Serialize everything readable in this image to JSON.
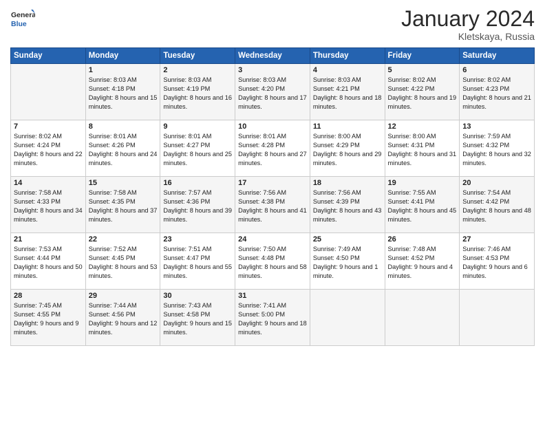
{
  "header": {
    "logo_general": "General",
    "logo_blue": "Blue",
    "month_title": "January 2024",
    "location": "Kletskaya, Russia"
  },
  "days_of_week": [
    "Sunday",
    "Monday",
    "Tuesday",
    "Wednesday",
    "Thursday",
    "Friday",
    "Saturday"
  ],
  "weeks": [
    [
      {
        "day": "",
        "sunrise": "",
        "sunset": "",
        "daylight": ""
      },
      {
        "day": "1",
        "sunrise": "Sunrise: 8:03 AM",
        "sunset": "Sunset: 4:18 PM",
        "daylight": "Daylight: 8 hours and 15 minutes."
      },
      {
        "day": "2",
        "sunrise": "Sunrise: 8:03 AM",
        "sunset": "Sunset: 4:19 PM",
        "daylight": "Daylight: 8 hours and 16 minutes."
      },
      {
        "day": "3",
        "sunrise": "Sunrise: 8:03 AM",
        "sunset": "Sunset: 4:20 PM",
        "daylight": "Daylight: 8 hours and 17 minutes."
      },
      {
        "day": "4",
        "sunrise": "Sunrise: 8:03 AM",
        "sunset": "Sunset: 4:21 PM",
        "daylight": "Daylight: 8 hours and 18 minutes."
      },
      {
        "day": "5",
        "sunrise": "Sunrise: 8:02 AM",
        "sunset": "Sunset: 4:22 PM",
        "daylight": "Daylight: 8 hours and 19 minutes."
      },
      {
        "day": "6",
        "sunrise": "Sunrise: 8:02 AM",
        "sunset": "Sunset: 4:23 PM",
        "daylight": "Daylight: 8 hours and 21 minutes."
      }
    ],
    [
      {
        "day": "7",
        "sunrise": "Sunrise: 8:02 AM",
        "sunset": "Sunset: 4:24 PM",
        "daylight": "Daylight: 8 hours and 22 minutes."
      },
      {
        "day": "8",
        "sunrise": "Sunrise: 8:01 AM",
        "sunset": "Sunset: 4:26 PM",
        "daylight": "Daylight: 8 hours and 24 minutes."
      },
      {
        "day": "9",
        "sunrise": "Sunrise: 8:01 AM",
        "sunset": "Sunset: 4:27 PM",
        "daylight": "Daylight: 8 hours and 25 minutes."
      },
      {
        "day": "10",
        "sunrise": "Sunrise: 8:01 AM",
        "sunset": "Sunset: 4:28 PM",
        "daylight": "Daylight: 8 hours and 27 minutes."
      },
      {
        "day": "11",
        "sunrise": "Sunrise: 8:00 AM",
        "sunset": "Sunset: 4:29 PM",
        "daylight": "Daylight: 8 hours and 29 minutes."
      },
      {
        "day": "12",
        "sunrise": "Sunrise: 8:00 AM",
        "sunset": "Sunset: 4:31 PM",
        "daylight": "Daylight: 8 hours and 31 minutes."
      },
      {
        "day": "13",
        "sunrise": "Sunrise: 7:59 AM",
        "sunset": "Sunset: 4:32 PM",
        "daylight": "Daylight: 8 hours and 32 minutes."
      }
    ],
    [
      {
        "day": "14",
        "sunrise": "Sunrise: 7:58 AM",
        "sunset": "Sunset: 4:33 PM",
        "daylight": "Daylight: 8 hours and 34 minutes."
      },
      {
        "day": "15",
        "sunrise": "Sunrise: 7:58 AM",
        "sunset": "Sunset: 4:35 PM",
        "daylight": "Daylight: 8 hours and 37 minutes."
      },
      {
        "day": "16",
        "sunrise": "Sunrise: 7:57 AM",
        "sunset": "Sunset: 4:36 PM",
        "daylight": "Daylight: 8 hours and 39 minutes."
      },
      {
        "day": "17",
        "sunrise": "Sunrise: 7:56 AM",
        "sunset": "Sunset: 4:38 PM",
        "daylight": "Daylight: 8 hours and 41 minutes."
      },
      {
        "day": "18",
        "sunrise": "Sunrise: 7:56 AM",
        "sunset": "Sunset: 4:39 PM",
        "daylight": "Daylight: 8 hours and 43 minutes."
      },
      {
        "day": "19",
        "sunrise": "Sunrise: 7:55 AM",
        "sunset": "Sunset: 4:41 PM",
        "daylight": "Daylight: 8 hours and 45 minutes."
      },
      {
        "day": "20",
        "sunrise": "Sunrise: 7:54 AM",
        "sunset": "Sunset: 4:42 PM",
        "daylight": "Daylight: 8 hours and 48 minutes."
      }
    ],
    [
      {
        "day": "21",
        "sunrise": "Sunrise: 7:53 AM",
        "sunset": "Sunset: 4:44 PM",
        "daylight": "Daylight: 8 hours and 50 minutes."
      },
      {
        "day": "22",
        "sunrise": "Sunrise: 7:52 AM",
        "sunset": "Sunset: 4:45 PM",
        "daylight": "Daylight: 8 hours and 53 minutes."
      },
      {
        "day": "23",
        "sunrise": "Sunrise: 7:51 AM",
        "sunset": "Sunset: 4:47 PM",
        "daylight": "Daylight: 8 hours and 55 minutes."
      },
      {
        "day": "24",
        "sunrise": "Sunrise: 7:50 AM",
        "sunset": "Sunset: 4:48 PM",
        "daylight": "Daylight: 8 hours and 58 minutes."
      },
      {
        "day": "25",
        "sunrise": "Sunrise: 7:49 AM",
        "sunset": "Sunset: 4:50 PM",
        "daylight": "Daylight: 9 hours and 1 minute."
      },
      {
        "day": "26",
        "sunrise": "Sunrise: 7:48 AM",
        "sunset": "Sunset: 4:52 PM",
        "daylight": "Daylight: 9 hours and 4 minutes."
      },
      {
        "day": "27",
        "sunrise": "Sunrise: 7:46 AM",
        "sunset": "Sunset: 4:53 PM",
        "daylight": "Daylight: 9 hours and 6 minutes."
      }
    ],
    [
      {
        "day": "28",
        "sunrise": "Sunrise: 7:45 AM",
        "sunset": "Sunset: 4:55 PM",
        "daylight": "Daylight: 9 hours and 9 minutes."
      },
      {
        "day": "29",
        "sunrise": "Sunrise: 7:44 AM",
        "sunset": "Sunset: 4:56 PM",
        "daylight": "Daylight: 9 hours and 12 minutes."
      },
      {
        "day": "30",
        "sunrise": "Sunrise: 7:43 AM",
        "sunset": "Sunset: 4:58 PM",
        "daylight": "Daylight: 9 hours and 15 minutes."
      },
      {
        "day": "31",
        "sunrise": "Sunrise: 7:41 AM",
        "sunset": "Sunset: 5:00 PM",
        "daylight": "Daylight: 9 hours and 18 minutes."
      },
      {
        "day": "",
        "sunrise": "",
        "sunset": "",
        "daylight": ""
      },
      {
        "day": "",
        "sunrise": "",
        "sunset": "",
        "daylight": ""
      },
      {
        "day": "",
        "sunrise": "",
        "sunset": "",
        "daylight": ""
      }
    ]
  ]
}
